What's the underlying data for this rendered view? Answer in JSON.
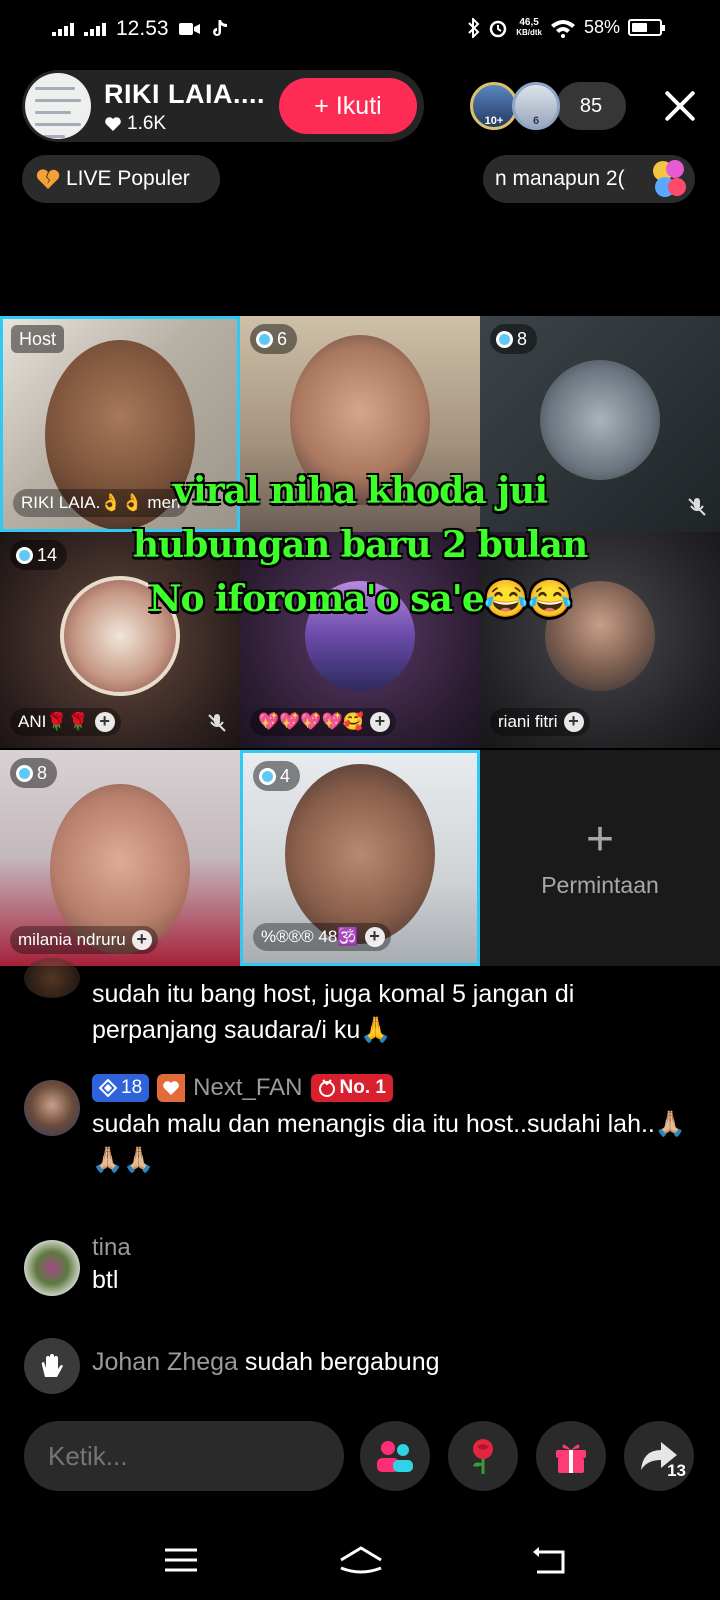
{
  "status_bar": {
    "time": "12.53",
    "net_speed_value": "46,5",
    "net_speed_unit": "KB/dtk",
    "battery": "58%",
    "battery_level": 0.58
  },
  "host": {
    "name": "RIKI LAIA....",
    "likes": "1.6K",
    "follow_label": "+ Ikuti"
  },
  "viewers": {
    "badge_a": "10+",
    "badge_b": "6",
    "count": "85"
  },
  "badges": {
    "live_popular": "LIVE Populer",
    "marquee": "n manapun 2("
  },
  "grid": {
    "host_tag": "Host",
    "tiles": [
      {
        "level": "",
        "name": "RIKI LAIA.👌👌 men"
      },
      {
        "level": "6",
        "name": ""
      },
      {
        "level": "8",
        "name": ""
      },
      {
        "level": "14",
        "name": "ANI🌹🌹"
      },
      {
        "level": "",
        "name": "💖💖💖💖🥰"
      },
      {
        "level": "",
        "name": "riani fitri"
      },
      {
        "level": "8",
        "name": "milania ndruru"
      },
      {
        "level": "4",
        "name": "%®®® 48🕉️"
      }
    ],
    "request_label": "Permintaan"
  },
  "overlay": {
    "line1": "viral niha khoda jui",
    "line2": "hubungan baru 2 bulan",
    "line3": "No iforoma'o sa'e😂😂"
  },
  "chat": {
    "messages": [
      {
        "text": "sudah itu bang host, juga komal 5 jangan di perpanjang saudara/i ku🙏"
      },
      {
        "level": "18",
        "fan": "Next_FAN",
        "rank": "No. 1",
        "text": "sudah malu dan menangis dia itu host..sudahi lah..🙏🏼🙏🏼🙏🏼"
      },
      {
        "user": "tina",
        "text": "btl"
      },
      {
        "user": "Johan Zhega",
        "text": "sudah bergabung"
      }
    ]
  },
  "bottom": {
    "comment_placeholder": "Ketik...",
    "share_count": "13"
  },
  "colors": {
    "accent": "#fe2c55",
    "overlay_text": "#3dff2a",
    "active_border": "#2fc9f3"
  }
}
